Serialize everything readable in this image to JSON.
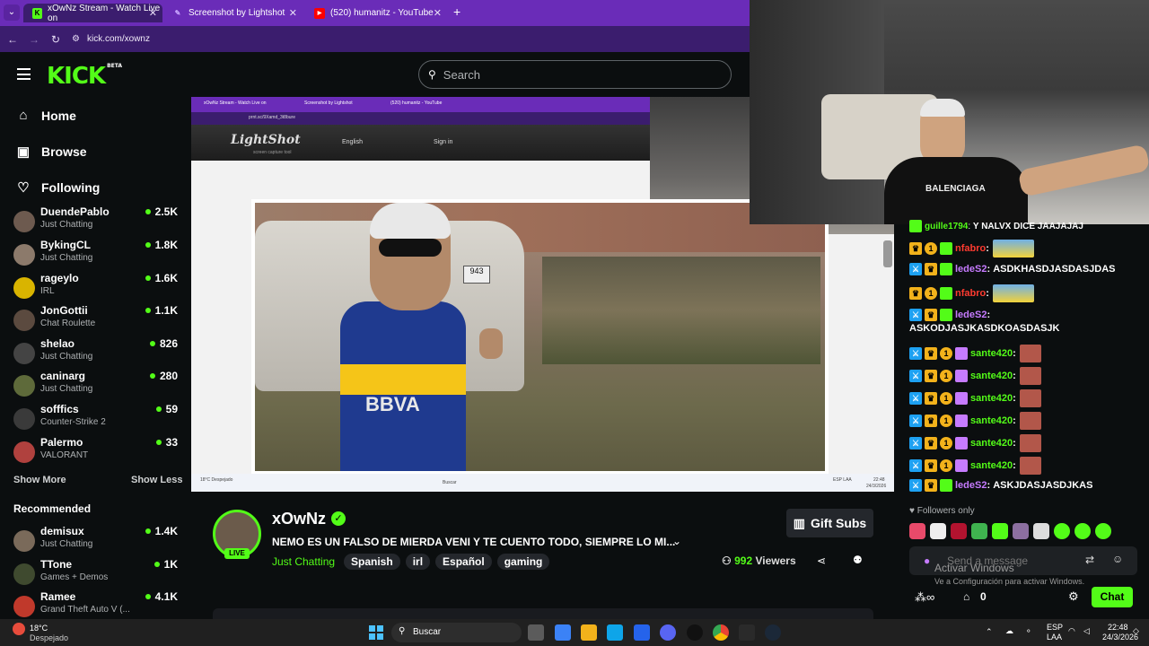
{
  "browser": {
    "tabs": [
      {
        "label": "xOwNz Stream - Watch Live on",
        "icon": "kick-favicon"
      },
      {
        "label": "Screenshot by Lightshot",
        "icon": "lightshot-favicon"
      },
      {
        "label": "(520) humanitz - YouTube",
        "icon": "youtube-favicon"
      }
    ],
    "new_tab": "+",
    "url": "kick.com/xownz"
  },
  "header": {
    "logo": "KICK",
    "logo_badge": "BETA",
    "search_placeholder": "Search"
  },
  "sidebar": {
    "nav": [
      {
        "label": "Home",
        "icon": "home-icon"
      },
      {
        "label": "Browse",
        "icon": "browse-icon"
      },
      {
        "label": "Following",
        "icon": "heart-icon"
      }
    ],
    "following": [
      {
        "name": "DuendePablo",
        "category": "Just Chatting",
        "viewers": "2.5K",
        "color": "#6d5a4f"
      },
      {
        "name": "BykingCL",
        "category": "Just Chatting",
        "viewers": "1.8K",
        "color": "#8c7a6b"
      },
      {
        "name": "rageylo",
        "category": "IRL",
        "viewers": "1.6K",
        "color": "#d9b400"
      },
      {
        "name": "JonGottii",
        "category": "Chat Roulette",
        "viewers": "1.1K",
        "color": "#5b4a3f"
      },
      {
        "name": "shelao",
        "category": "Just Chatting",
        "viewers": "826",
        "color": "#444444"
      },
      {
        "name": "caninarg",
        "category": "Just Chatting",
        "viewers": "280",
        "color": "#5e6a3a"
      },
      {
        "name": "sofffics",
        "category": "Counter-Strike 2",
        "viewers": "59",
        "color": "#3a3a3a"
      },
      {
        "name": "Palermo",
        "category": "VALORANT",
        "viewers": "33",
        "color": "#b0413e"
      }
    ],
    "show_more": "Show More",
    "show_less": "Show Less",
    "recommended_title": "Recommended",
    "recommended": [
      {
        "name": "demisux",
        "category": "Just Chatting",
        "viewers": "1.4K",
        "color": "#7a6a5a"
      },
      {
        "name": "TTone",
        "category": "Games + Demos",
        "viewers": "1K",
        "color": "#3f4a2f"
      },
      {
        "name": "Ramee",
        "category": "Grand Theft Auto V (...",
        "viewers": "4.1K",
        "color": "#c0392b"
      }
    ]
  },
  "player": {
    "inner_tabs": [
      "xOwNz Stream - Watch Live on",
      "Screenshot by Lightshot",
      "(520) humanitz - YouTube"
    ],
    "inner_url": "prnt.sc/9Xamd_3t8bure",
    "lightshot_logo": "LightShot",
    "lightshot_sub": "screen capture tool",
    "lightshot_lang": "English",
    "lightshot_signin": "Sign in",
    "shirt_text": "BBVA",
    "plate_text": "943",
    "inner_weather": "18°C Despejado",
    "inner_search": "Buscar",
    "inner_lang": "ESP LAA",
    "inner_time": "22:48",
    "inner_date": "24/3/2026"
  },
  "cam": {
    "shirt_text": "BALENCIAGA"
  },
  "stream": {
    "live_badge": "LIVE",
    "streamer": "xOwNz",
    "title": "NEMO ES UN FALSO DE MIERDA VENI Y TE CUENTO TODO, SIEMPRE LO MI...",
    "category": "Just Chatting",
    "tags": [
      "Spanish",
      "irl",
      "Español",
      "gaming"
    ],
    "gift_subs": "Gift Subs",
    "viewers": "992",
    "viewers_label": "Viewers"
  },
  "chat": {
    "messages": [
      {
        "user": "guille1794",
        "text": "Y NALVX DICE JAAJAJAJ",
        "user_color": "#53fc18",
        "badges": [
          "gift-green"
        ]
      },
      {
        "user": "nfabro",
        "text": "",
        "user_color": "#ff3b30",
        "badges": [
          "crown",
          "coin",
          "gift-green"
        ],
        "emote": "minion"
      },
      {
        "user": "ledeS2",
        "text": "ASDKHASDJASDASJDAS",
        "user_color": "#c67bff",
        "badges": [
          "sword",
          "crown",
          "gift-green"
        ]
      },
      {
        "user": "nfabro",
        "text": "",
        "user_color": "#ff3b30",
        "badges": [
          "crown",
          "coin",
          "gift-green"
        ],
        "emote": "minion"
      },
      {
        "user": "ledeS2",
        "text": "ASKODJASJKASDKOASDASJK",
        "user_color": "#c67bff",
        "badges": [
          "sword",
          "crown",
          "gift-green"
        ]
      },
      {
        "user": "sante420",
        "text": "",
        "user_color": "#53fc18",
        "badges": [
          "sword",
          "crown",
          "coin",
          "gift-purple"
        ],
        "emote": "face"
      },
      {
        "user": "sante420",
        "text": "",
        "user_color": "#53fc18",
        "badges": [
          "sword",
          "crown",
          "coin",
          "gift-purple"
        ],
        "emote": "face"
      },
      {
        "user": "sante420",
        "text": "",
        "user_color": "#53fc18",
        "badges": [
          "sword",
          "crown",
          "coin",
          "gift-purple"
        ],
        "emote": "face"
      },
      {
        "user": "sante420",
        "text": "",
        "user_color": "#53fc18",
        "badges": [
          "sword",
          "crown",
          "coin",
          "gift-purple"
        ],
        "emote": "face"
      },
      {
        "user": "sante420",
        "text": "",
        "user_color": "#53fc18",
        "badges": [
          "sword",
          "crown",
          "coin",
          "gift-purple"
        ],
        "emote": "face"
      },
      {
        "user": "sante420",
        "text": "",
        "user_color": "#53fc18",
        "badges": [
          "sword",
          "crown",
          "coin",
          "gift-purple"
        ],
        "emote": "face"
      },
      {
        "user": "ledeS2",
        "text": "ASKJDASJASDJKAS",
        "user_color": "#c67bff",
        "badges": [
          "sword",
          "crown",
          "gift-green"
        ]
      }
    ],
    "followers_only": "Followers only",
    "input_placeholder": "Send a message",
    "activate_title": "Activar Windows",
    "activate_sub": "Ve a Configuración para activar Windows.",
    "points": "0",
    "chat_button": "Chat"
  },
  "taskbar": {
    "weather_temp": "18°C",
    "weather_desc": "Despejado",
    "search": "Buscar",
    "lang_top": "ESP",
    "lang_bottom": "LAA",
    "time": "22:48",
    "date": "24/3/2026"
  }
}
